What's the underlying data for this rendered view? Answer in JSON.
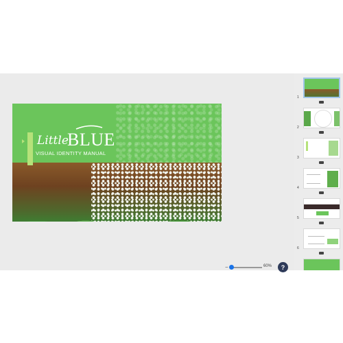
{
  "slide": {
    "logo_script": "Little",
    "logo_main": "BLUE",
    "subtitle": "VISUAL IDENTITY MANUAL"
  },
  "thumbnails": [
    {
      "number": "1",
      "selected": true
    },
    {
      "number": "2",
      "selected": false
    },
    {
      "number": "3",
      "selected": false
    },
    {
      "number": "4",
      "selected": false
    },
    {
      "number": "5",
      "selected": false
    },
    {
      "number": "6",
      "selected": false
    }
  ],
  "zoom": {
    "minus_icon": "−",
    "percent": "60%"
  },
  "help": {
    "label": "?"
  },
  "colors": {
    "slide_green": "#6bc55b",
    "accent_lime": "#b6e27a",
    "help_bg": "#2e3a59"
  }
}
